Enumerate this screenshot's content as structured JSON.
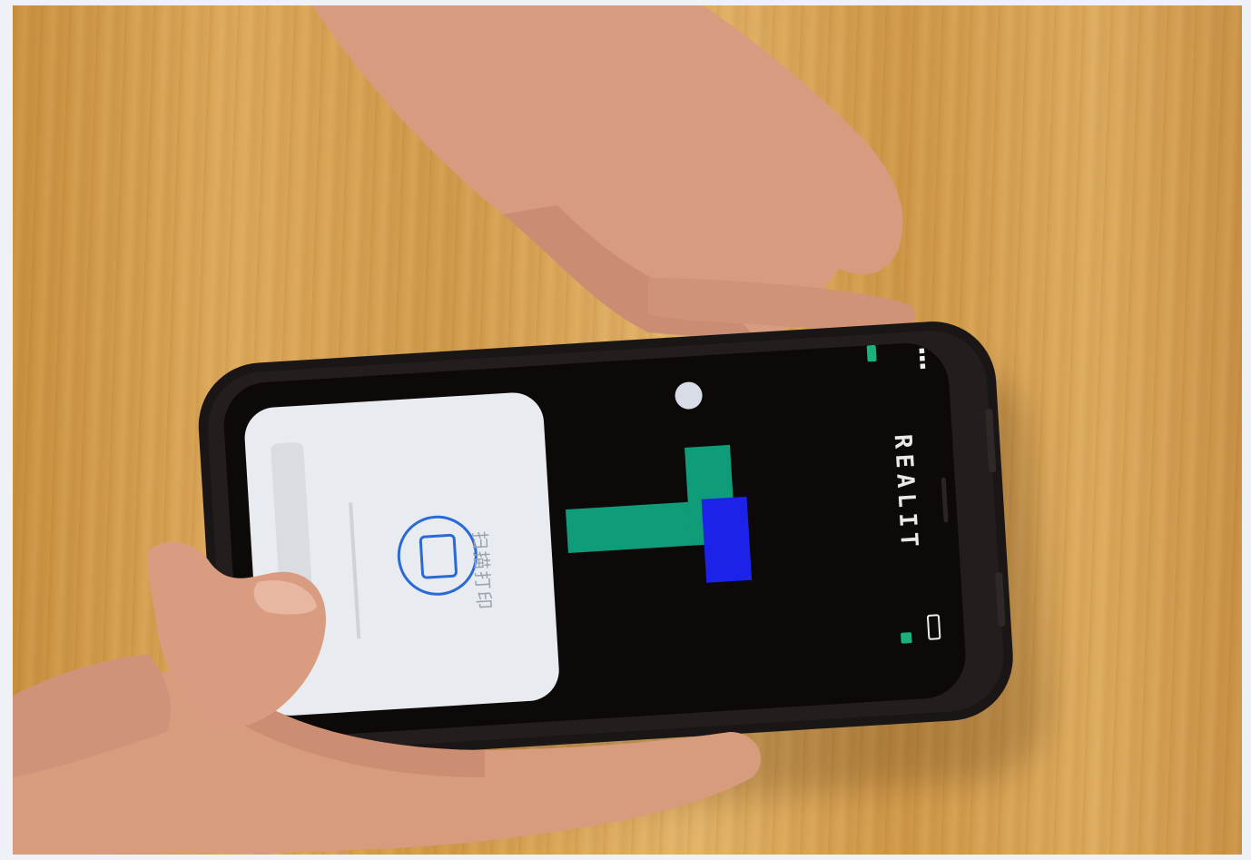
{
  "phone_screen": {
    "brand_text": "REALIT",
    "popup_text": "扫描打印",
    "colors": {
      "teal_block": "#0f9c78",
      "blue_block": "#1c22e8",
      "screen_bg": "#0d0909",
      "popup_bg": "#e8ebef",
      "popup_icon": "#2a6ad8"
    }
  }
}
